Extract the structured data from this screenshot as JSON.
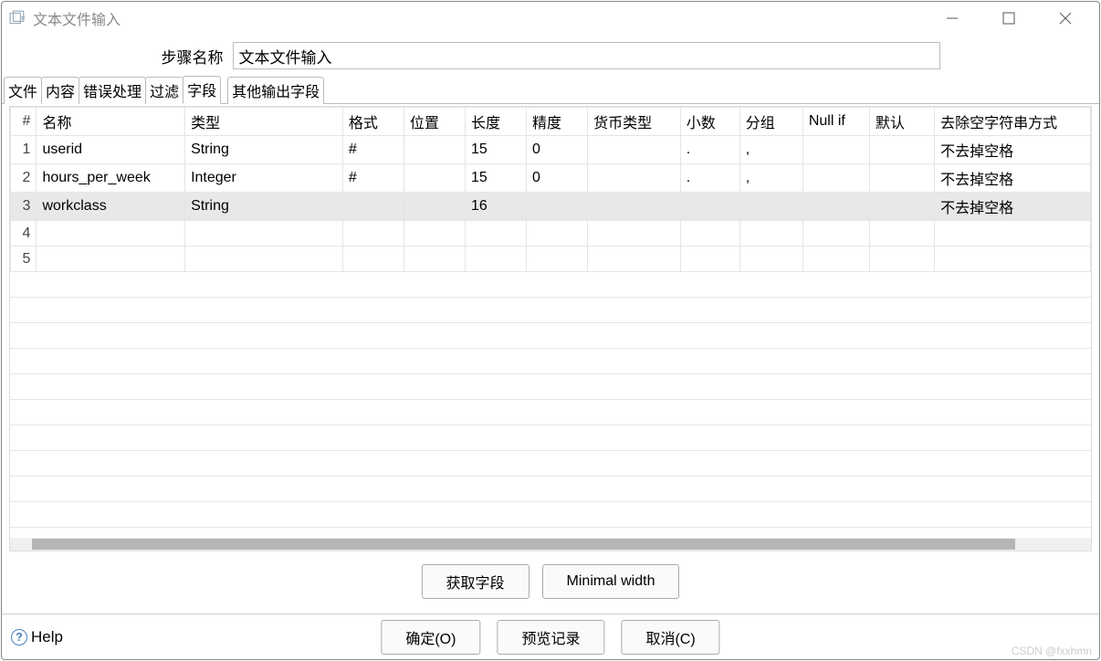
{
  "window": {
    "title": "文本文件输入"
  },
  "step": {
    "label": "步骤名称",
    "value": "文本文件输入"
  },
  "tabs": [
    {
      "label": "文件",
      "active": false
    },
    {
      "label": "内容",
      "active": false
    },
    {
      "label": "错误处理",
      "active": false
    },
    {
      "label": "过滤",
      "active": false
    },
    {
      "label": "字段",
      "active": true
    },
    {
      "label": "其他输出字段",
      "active": false
    }
  ],
  "table": {
    "headers": {
      "idx": "#",
      "name": "名称",
      "type": "类型",
      "format": "格式",
      "position": "位置",
      "length": "长度",
      "precision": "精度",
      "currency": "货币类型",
      "decimal": "小数",
      "group": "分组",
      "nullif": "Null if",
      "default": "默认",
      "trim": "去除空字符串方式"
    },
    "rows": [
      {
        "idx": "1",
        "name": "userid",
        "type": "String",
        "format": "#",
        "position": "",
        "length": "15",
        "precision": "0",
        "currency": "",
        "decimal": ".",
        "group": ",",
        "nullif": "",
        "default": "",
        "trim": "不去掉空格",
        "selected": false
      },
      {
        "idx": "2",
        "name": "hours_per_week",
        "type": "Integer",
        "format": "#",
        "position": "",
        "length": "15",
        "precision": "0",
        "currency": "",
        "decimal": ".",
        "group": ",",
        "nullif": "",
        "default": "",
        "trim": "不去掉空格",
        "selected": false
      },
      {
        "idx": "3",
        "name": "workclass",
        "type": "String",
        "format": "",
        "position": "",
        "length": "16",
        "precision": "",
        "currency": "",
        "decimal": "",
        "group": "",
        "nullif": "",
        "default": "",
        "trim": "不去掉空格",
        "selected": true
      },
      {
        "idx": "4",
        "name": "",
        "type": "",
        "format": "",
        "position": "",
        "length": "",
        "precision": "",
        "currency": "",
        "decimal": "",
        "group": "",
        "nullif": "",
        "default": "",
        "trim": "",
        "selected": false
      },
      {
        "idx": "5",
        "name": "",
        "type": "",
        "format": "",
        "position": "",
        "length": "",
        "precision": "",
        "currency": "",
        "decimal": "",
        "group": "",
        "nullif": "",
        "default": "",
        "trim": "",
        "selected": false
      }
    ]
  },
  "buttons": {
    "get_fields": "获取字段",
    "minimal_width": "Minimal width",
    "ok": "确定(O)",
    "preview": "预览记录",
    "cancel": "取消(C)",
    "help": "Help"
  },
  "watermark": "CSDN @fxxhmn"
}
